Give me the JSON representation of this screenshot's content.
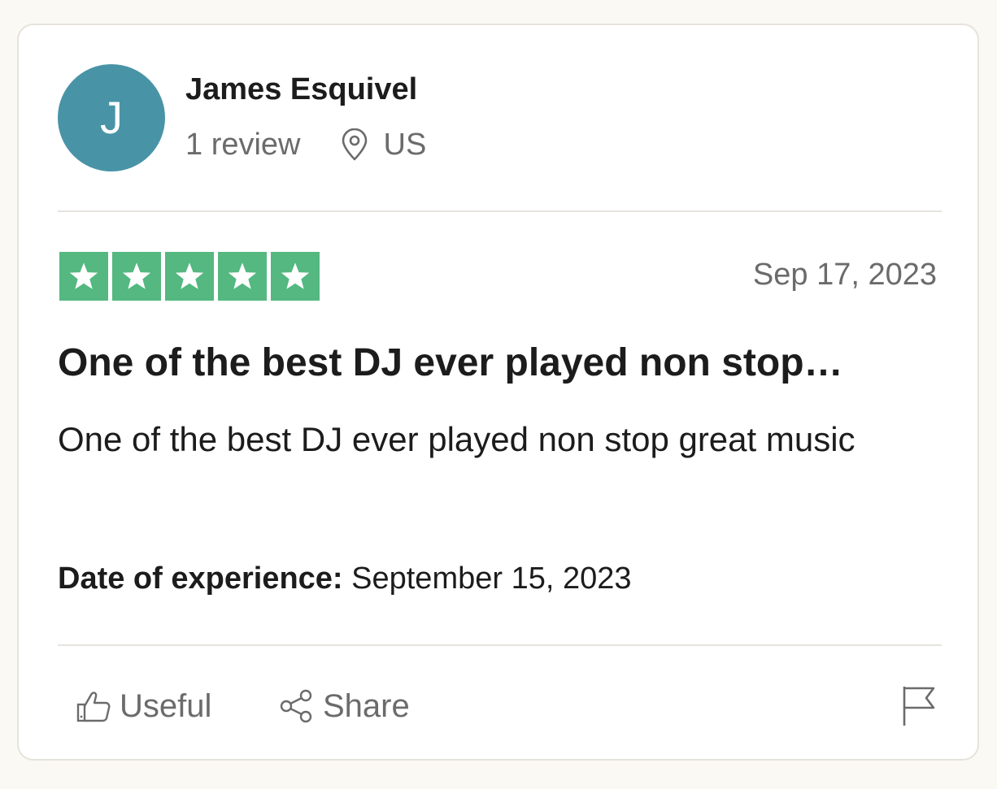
{
  "reviewer": {
    "initial": "J",
    "name": "James Esquivel",
    "review_count": "1 review",
    "location_icon": "location-pin-icon",
    "country": "US",
    "avatar_color": "#4894a6"
  },
  "rating": {
    "stars": 5,
    "max_stars": 5,
    "star_color": "#54b880"
  },
  "review": {
    "date": "Sep 17, 2023",
    "title": "One of the best DJ ever played non stop…",
    "body": "One of the best DJ ever played non stop great music",
    "experience_label": "Date of experience:",
    "experience_date": "September 15, 2023"
  },
  "actions": {
    "useful_label": "Useful",
    "useful_icon": "thumbs-up-icon",
    "share_label": "Share",
    "share_icon": "share-icon",
    "report_icon": "flag-icon"
  }
}
